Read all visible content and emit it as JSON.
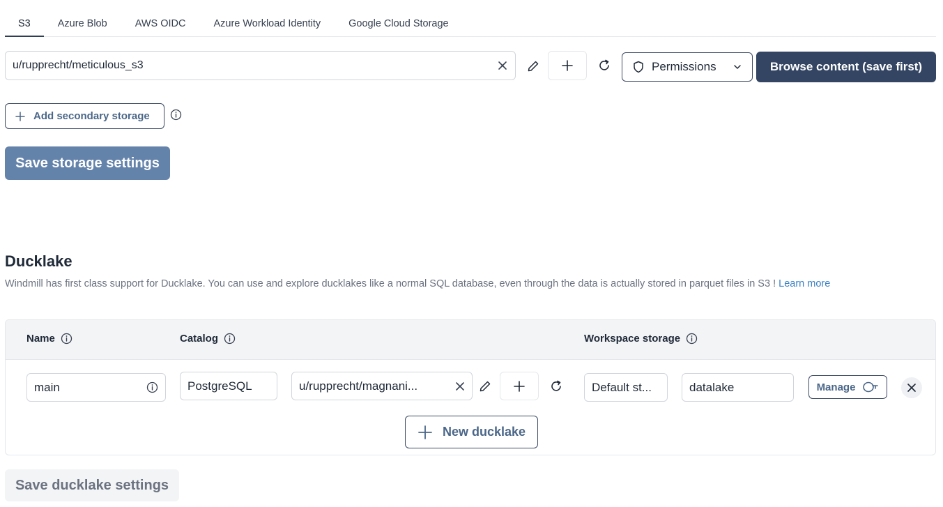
{
  "tabs": [
    {
      "label": "S3",
      "active": true
    },
    {
      "label": "Azure Blob",
      "active": false
    },
    {
      "label": "AWS OIDC",
      "active": false
    },
    {
      "label": "Azure Workload Identity",
      "active": false
    },
    {
      "label": "Google Cloud Storage",
      "active": false
    }
  ],
  "storage": {
    "resource_value": "u/rupprecht/meticulous_s3",
    "permissions_label": "Permissions",
    "browse_label": "Browse content (save first)",
    "add_secondary_label": "Add secondary storage",
    "save_label": "Save storage settings"
  },
  "ducklake": {
    "title": "Ducklake",
    "description": "Windmill has first class support for Ducklake. You can use and explore ducklakes like a normal SQL database, even through the data is actually stored in parquet files in S3 !",
    "learn_more": "Learn more",
    "columns": {
      "name": "Name",
      "catalog": "Catalog",
      "workspace_storage": "Workspace storage"
    },
    "rows": [
      {
        "name": "main",
        "catalog_type": "PostgreSQL",
        "catalog_resource": "u/rupprecht/magnani...",
        "storage": "Default st...",
        "path": "datalake",
        "manage_label": "Manage"
      }
    ],
    "new_label": "New ducklake",
    "save_label": "Save ducklake settings"
  },
  "colors": {
    "primary": "#334563",
    "primary_light": "#6483ab",
    "link": "#3b82c4"
  }
}
